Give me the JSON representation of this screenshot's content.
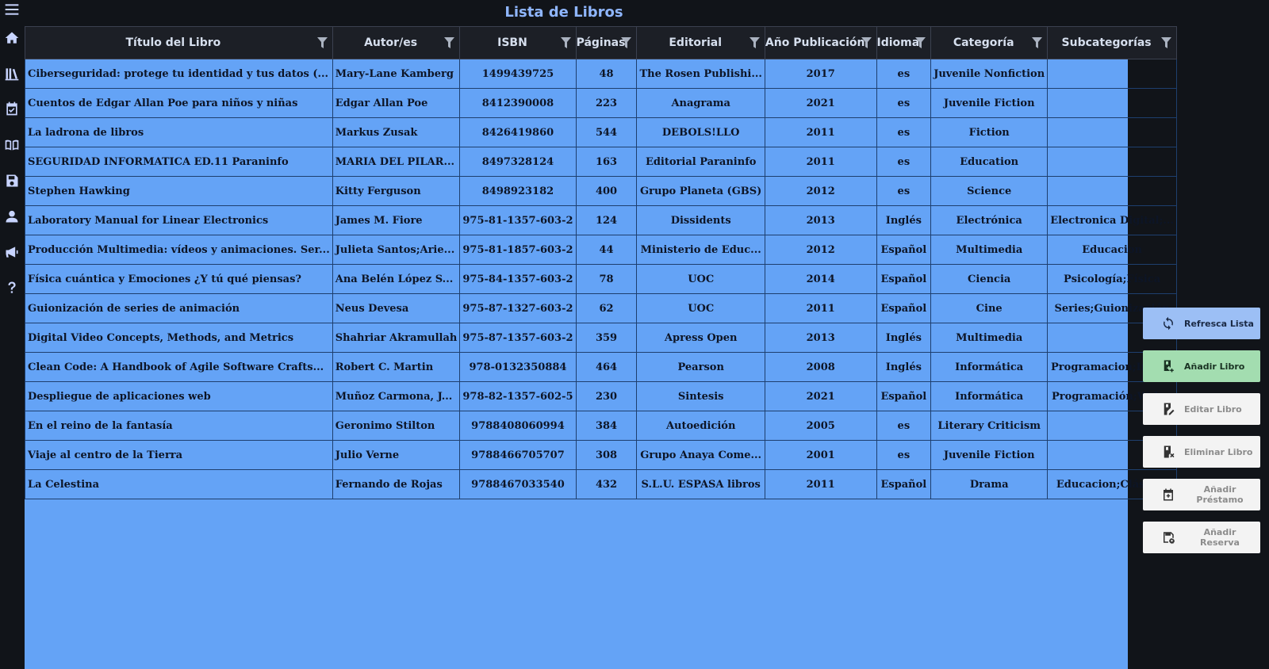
{
  "title": "Lista de Libros",
  "sidebar": {
    "items": [
      {
        "icon": "menu-icon"
      },
      {
        "icon": "home-icon"
      },
      {
        "icon": "library-icon"
      },
      {
        "icon": "calendar-check-icon"
      },
      {
        "icon": "open-book-icon"
      },
      {
        "icon": "save-icon"
      },
      {
        "icon": "user-icon"
      },
      {
        "icon": "megaphone-icon"
      },
      {
        "icon": "help-icon"
      }
    ]
  },
  "table": {
    "columns": [
      "Título del Libro",
      "Autor/es",
      "ISBN",
      "Páginas",
      "Editorial",
      "Año Publicación",
      "Idioma",
      "Categoría",
      "Subcategorías"
    ],
    "rows": [
      [
        "Ciberseguridad: protege tu identidad y tus datos (...",
        "Mary-Lane Kamberg",
        "1499439725",
        "48",
        "The Rosen Publishi...",
        "2017",
        "es",
        "Juvenile Nonfiction",
        ""
      ],
      [
        "Cuentos de Edgar Allan Poe para niños y niñas",
        "Edgar Allan Poe",
        "8412390008",
        "223",
        "Anagrama",
        "2021",
        "es",
        "Juvenile Fiction",
        ""
      ],
      [
        "La ladrona de libros",
        "Markus Zusak",
        "8426419860",
        "544",
        "DEBOLS!LLO",
        "2011",
        "es",
        "Fiction",
        ""
      ],
      [
        "SEGURIDAD INFORMATICA ED.11 Paraninfo",
        "MARIA DEL PILAR...",
        "8497328124",
        "163",
        "Editorial Paraninfo",
        "2011",
        "es",
        "Education",
        ""
      ],
      [
        "Stephen Hawking",
        "Kitty Ferguson",
        "8498923182",
        "400",
        "Grupo Planeta (GBS)",
        "2012",
        "es",
        "Science",
        ""
      ],
      [
        "Laboratory Manual for Linear Electronics",
        "James M. Fiore",
        "975-81-1357-603-2",
        "124",
        "Dissidents",
        "2013",
        "Inglés",
        "Electrónica",
        "Electronica Digital;..."
      ],
      [
        "Producción Multimedia: vídeos y animaciones. Ser...",
        "Julieta Santos;Arie...",
        "975-81-1857-603-2",
        "44",
        "Ministerio de Educ...",
        "2012",
        "Español",
        "Multimedia",
        "Educacion"
      ],
      [
        "Física cuántica y Emociones ¿Y tú qué piensas?",
        "Ana Belén López S...",
        "975-84-1357-603-2",
        "78",
        "UOC",
        "2014",
        "Español",
        "Ciencia",
        "Psicología;Física"
      ],
      [
        "Guionización de series de animación",
        "Neus Devesa",
        "975-87-1327-603-2",
        "62",
        "UOC",
        "2011",
        "Español",
        "Cine",
        "Series;Guionización"
      ],
      [
        "Digital Video Concepts, Methods, and Metrics",
        "Shahriar Akramullah",
        "975-87-1357-603-2",
        "359",
        "Apress Open",
        "2013",
        "Inglés",
        "Multimedia",
        ""
      ],
      [
        "Clean Code: A Handbook of Agile Software Crafts...",
        "Robert C. Martin",
        "978-0132350884",
        "464",
        "Pearson",
        "2008",
        "Inglés",
        "Informática",
        "Programacion;Inge..."
      ],
      [
        "Despliegue de aplicaciones web",
        "Muñoz Carmona, J...",
        "978-82-1357-602-5",
        "230",
        "Sintesis",
        "2021",
        "Español",
        "Informática",
        "Programación;Web..."
      ],
      [
        "En el reino de la fantasía",
        "Geronimo Stilton",
        "9788408060994",
        "384",
        "Autoedición",
        "2005",
        "es",
        "Literary Criticism",
        ""
      ],
      [
        "Viaje al centro de la Tierra",
        "Julio Verne",
        "9788466705707",
        "308",
        "Grupo Anaya Come...",
        "2001",
        "es",
        "Juvenile Fiction",
        ""
      ],
      [
        "La Celestina",
        "Fernando de Rojas",
        "9788467033540",
        "432",
        "S.L.U. ESPASA libros",
        "2011",
        "Español",
        "Drama",
        "Educacion;Clásicos"
      ]
    ]
  },
  "actions": {
    "refresh": "Refresca Lista",
    "add": "Añadir Libro",
    "edit": "Editar Libro",
    "delete": "Eliminar Libro",
    "add_loan": "Añadir Préstamo",
    "add_reservation": "Añadir Reserva"
  },
  "colors": {
    "background": "#111419",
    "table_fill": "#64a3f6",
    "header_fill": "#1c1f26",
    "title": "#8fb6ff",
    "refresh_button": "#9cbff5",
    "add_button": "#a3ddb0",
    "disabled_button": "#f3f3f3"
  }
}
